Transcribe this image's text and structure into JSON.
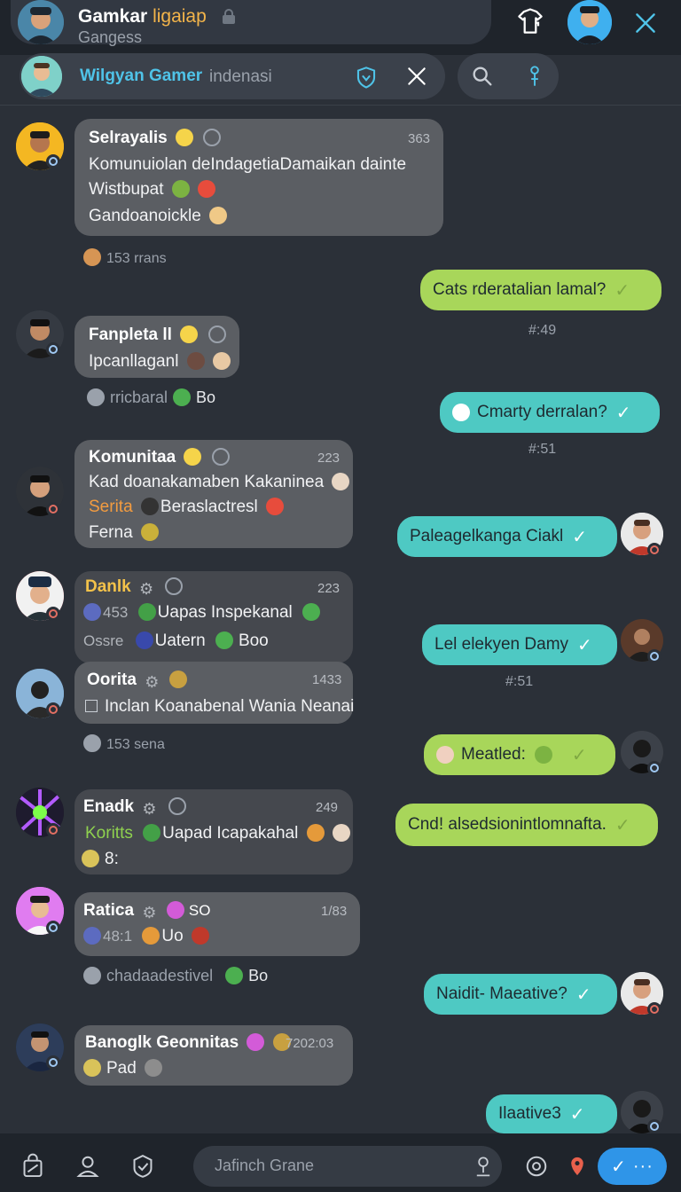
{
  "header": {
    "title_main": "Gamkar",
    "title_accent": "ligaiap",
    "subtitle": "Gangess"
  },
  "search": {
    "name": "Wilgyan Gamer",
    "text": "indenasi"
  },
  "messages": {
    "m1": {
      "name": "Selrayalis",
      "time": "363",
      "line1": "Komunuiolan deIndagetiaDamaikan dainte",
      "line2": "Wistbupat",
      "line3": "Gandoanoickle",
      "meta": "153 rrans"
    },
    "o1": {
      "text": "Cats rderatalian lamal?",
      "sep": "#:49"
    },
    "m2": {
      "name": "Fanpleta ll",
      "line1": "Ipcanllaganl",
      "meta": "rricbaral",
      "meta2": "Bo"
    },
    "o2": {
      "text": "Cmarty derralan?",
      "sep": "#:51"
    },
    "m3": {
      "name": "Komunitaa",
      "time": "223",
      "line1": "Kad doanakamaben Kakaninea",
      "line2a": "Serita",
      "line2b": "Beraslactresl",
      "line3": "Ferna"
    },
    "o3": {
      "text": "Paleagelkanga Ciakl"
    },
    "m4": {
      "name": "Danlk",
      "time": "223",
      "line1a": "453",
      "line1b": "Uapas Inspekanal",
      "line2a": "Ossre",
      "line2b": "Uatern",
      "line2c": "Boo"
    },
    "o4": {
      "text": "Lel elekyen Damy",
      "sep": "#:51"
    },
    "m5": {
      "name": "Oorita",
      "time": "1433",
      "line1": "Inclan Koanabenal Wania Neanai",
      "meta": "153 sena"
    },
    "o5": {
      "text": "Meatled:"
    },
    "m6": {
      "name": "Enadk",
      "time": "249",
      "line1a": "Koritts",
      "line1b": "Uapad Icapakahal",
      "line2": "8:"
    },
    "o6": {
      "text": "Cnd! alsedsionintlomnafta."
    },
    "m7": {
      "name": "Ratica",
      "time": "1/83",
      "name_extra": "SO",
      "line1a": "48:1",
      "line1b": "Uo",
      "meta": "chadaadestivel",
      "meta2": "Bo"
    },
    "o7": {
      "text": "Naidit- Maeative?"
    },
    "m8": {
      "name": "Banoglk Geonnitas",
      "time": "7202:03",
      "line1": "Pad"
    },
    "o8": {
      "text": "Ilaative3"
    }
  },
  "compose": {
    "placeholder": "Jafinch Grane"
  },
  "colors": {
    "lime": "#a8d65a",
    "teal": "#4ec9c3",
    "send": "#2f95e8",
    "accent": "#f3b44a",
    "link": "#4fc3e8"
  }
}
